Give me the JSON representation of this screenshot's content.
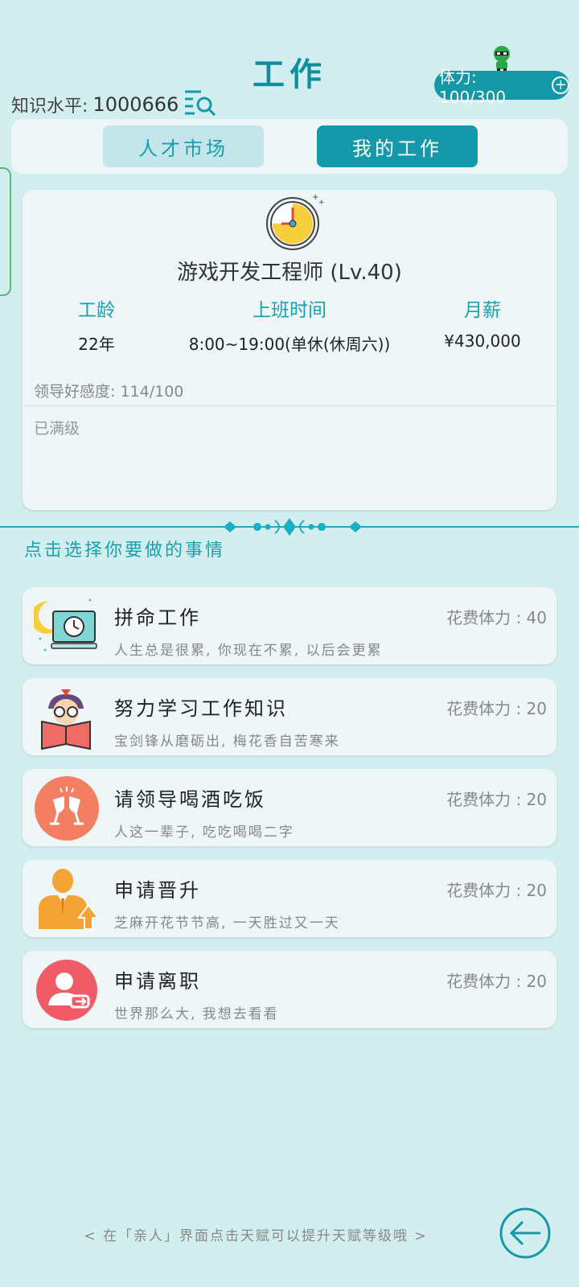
{
  "header": {
    "title": "工作",
    "knowledge_label": "知识水平:",
    "knowledge_value": "1000666",
    "stamina": "体力: 100/300"
  },
  "tabs": [
    {
      "label": "人才市场",
      "active": false
    },
    {
      "label": "我的工作",
      "active": true
    }
  ],
  "job": {
    "name": "游戏开发工程师 (Lv.40)",
    "stats": [
      {
        "label": "工龄",
        "value": "22年"
      },
      {
        "label": "上班时间",
        "value": "8:00~19:00(单休(休周六))"
      },
      {
        "label": "月薪",
        "value": "¥430,000"
      }
    ],
    "favor": "领导好感度: 114/100",
    "status": "已满级"
  },
  "prompt": "点击选择你要做的事情",
  "actions": [
    {
      "name": "拼命工作",
      "cost": "花费体力 : 40",
      "desc": "人生总是很累, 你现在不累, 以后会更累",
      "icon": "night-work-clock-icon"
    },
    {
      "name": "努力学习工作知识",
      "cost": "花费体力 : 20",
      "desc": "宝剑锋从磨砺出, 梅花香自苦寒来",
      "icon": "reading-book-icon"
    },
    {
      "name": "请领导喝酒吃饭",
      "cost": "花费体力 : 20",
      "desc": "人这一辈子, 吃吃喝喝二字",
      "icon": "toast-glasses-icon"
    },
    {
      "name": "申请晋升",
      "cost": "花费体力 : 20",
      "desc": "芝麻开花节节高, 一天胜过又一天",
      "icon": "promotion-person-icon"
    },
    {
      "name": "申请离职",
      "cost": "花费体力 : 20",
      "desc": "世界那么大, 我想去看看",
      "icon": "resign-user-icon"
    }
  ],
  "footer": {
    "hint": "< 在「亲人」界面点击天赋可以提升天赋等级哦 >"
  },
  "colors": {
    "background": "#d3eeee",
    "accent": "#1599aa",
    "card": "#eef6f7"
  }
}
